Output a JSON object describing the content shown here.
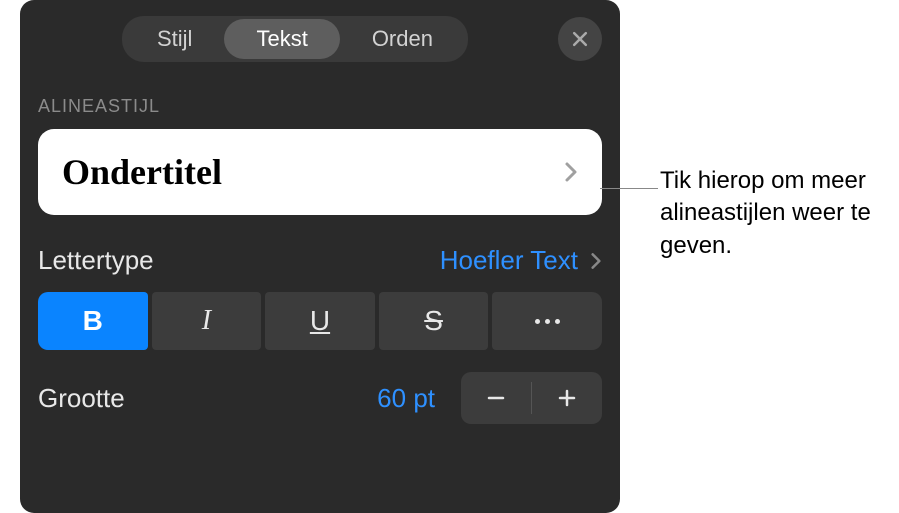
{
  "tabs": {
    "style": "Stijl",
    "text": "Tekst",
    "arrange": "Orden"
  },
  "section_label": "ALINEASTIJL",
  "paragraph_style": "Ondertitel",
  "font": {
    "label": "Lettertype",
    "value": "Hoefler Text"
  },
  "style_buttons": {
    "bold": "B",
    "italic": "I",
    "underline": "U",
    "strike": "S"
  },
  "size": {
    "label": "Grootte",
    "value": "60 pt"
  },
  "callout": "Tik hierop om meer alineastijlen weer te geven."
}
